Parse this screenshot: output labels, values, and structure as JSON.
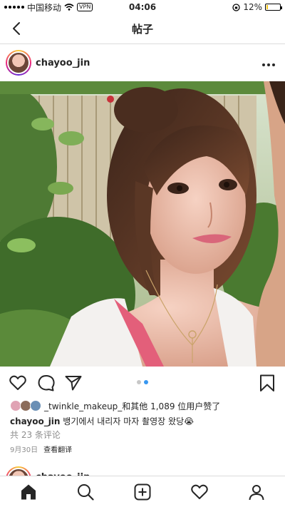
{
  "status_bar": {
    "carrier": "中国移动",
    "vpn": "VPN",
    "time": "04:06",
    "battery": "12%",
    "battery_level": 0.12
  },
  "nav": {
    "title": "帖子"
  },
  "post": {
    "username": "chayoo_jin",
    "carousel": {
      "count": 2,
      "active_index": 1
    },
    "likes_text": "_twinkle_makeup_和其他 1,089 位用户赞了",
    "caption_user": "chayoo_jin",
    "caption_text": "뱅기에서 내리자 마자 촬영장 왔당😭",
    "comments_text": "共 23 条评论",
    "date": "9月30日",
    "translate": "查看翻译"
  },
  "next_post": {
    "username": "chayoo_jin"
  },
  "icons": {
    "back": "chevron-left-icon",
    "more": "more-horizontal-icon",
    "like": "heart-icon",
    "comment": "comment-icon",
    "share": "paper-plane-icon",
    "save": "bookmark-icon",
    "home": "home-icon",
    "search": "search-icon",
    "new_post": "plus-square-icon",
    "activity": "heart-icon",
    "profile": "profile-icon"
  }
}
